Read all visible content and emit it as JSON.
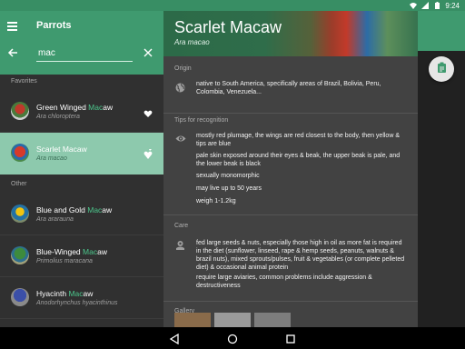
{
  "status_bar": {
    "time": "9:24"
  },
  "header": {
    "title": "Parrots",
    "search": {
      "value": "mac",
      "placeholder": ""
    }
  },
  "list": {
    "favorites_label": "Favorites",
    "other_label": "Other",
    "items": [
      {
        "name_before": "Green Winged ",
        "name_match": "Mac",
        "name_after": "aw",
        "latin": "Ara chloroptera",
        "section": "favorites",
        "selected": false
      },
      {
        "name_before": "Scarlet ",
        "name_match": "Mac",
        "name_after": "aw",
        "latin": "Ara macao",
        "section": "favorites",
        "selected": true
      },
      {
        "name_before": "Blue and Gold ",
        "name_match": "Mac",
        "name_after": "aw",
        "latin": "Ara ararauna",
        "section": "other",
        "selected": false
      },
      {
        "name_before": "Blue-Winged ",
        "name_match": "Mac",
        "name_after": "aw",
        "latin": "Primolius maracana",
        "section": "other",
        "selected": false
      },
      {
        "name_before": "Hyacinth ",
        "name_match": "Mac",
        "name_after": "aw",
        "latin": "Anodorhynchus hyacinthinus",
        "section": "other",
        "selected": false
      }
    ]
  },
  "detail": {
    "title": "Scarlet Macaw",
    "latin": "Ara macao",
    "origin_label": "Origin",
    "origin_text": "native to South America, specifically areas of Brazil, Bolivia, Peru, Colombia, Venezuela...",
    "tips_label": "Tips for recognition",
    "tips": [
      "mostly red plumage, the wings are red closest to the body, then yellow & tips are blue",
      "pale skin exposed around their eyes & beak, the upper beak is pale, and the lower beak is black",
      "sexually monomorphic",
      "may live up to 50 years",
      "weigh 1-1.2kg"
    ],
    "care_label": "Care",
    "care": [
      "fed large seeds & nuts, especially those high in oil as more fat is required in the diet (sunflower, linseed, rape & hemp seeds, peanuts, walnuts & brazil nuts), mixed sprouts/pulses, fruit & vegetables (or complete pelleted diet) & occasional animal protein",
      "require large aviaries, common problems include aggression & destructiveness"
    ],
    "gallery_label": "Gallery"
  },
  "colors": {
    "accent": "#3f9a6f",
    "status_bar": "#388e64",
    "selected_row": "#8dc9ad",
    "highlight": "#4cc68c"
  },
  "icons": {
    "menu": "menu-icon",
    "back": "arrow-back-icon",
    "clear": "close-icon",
    "favorite": "heart-icon",
    "origin": "globe-icon",
    "tips": "eye-icon",
    "care": "care-icon",
    "fab": "clipboard-icon"
  }
}
